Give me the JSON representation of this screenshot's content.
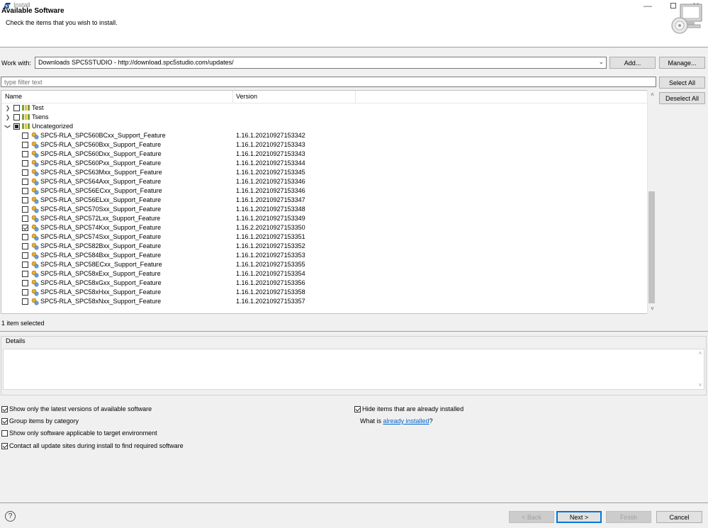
{
  "window": {
    "title": "Install"
  },
  "header": {
    "title": "Available Software",
    "subtitle": "Check the items that you wish to install."
  },
  "work_with": {
    "label": "Work with:",
    "value": "Downloads SPC5STUDIO - http://download.spc5studio.com/updates/",
    "add_label": "Add...",
    "manage_label": "Manage..."
  },
  "filter": {
    "placeholder": "type filter text"
  },
  "selection_buttons": {
    "select_all": "Select All",
    "deselect_all": "Deselect All"
  },
  "tree": {
    "columns": [
      "Name",
      "Version"
    ],
    "categories": [
      {
        "name": "Test",
        "expanded": false,
        "state": "unchecked"
      },
      {
        "name": "Tsens",
        "expanded": false,
        "state": "unchecked"
      },
      {
        "name": "Uncategorized",
        "expanded": true,
        "state": "partial"
      }
    ],
    "features": [
      {
        "name": "SPC5-RLA_SPC560BCxx_Support_Feature",
        "version": "1.16.1.20210927153342",
        "checked": false
      },
      {
        "name": "SPC5-RLA_SPC560Bxx_Support_Feature",
        "version": "1.16.1.20210927153343",
        "checked": false
      },
      {
        "name": "SPC5-RLA_SPC560Dxx_Support_Feature",
        "version": "1.16.1.20210927153343",
        "checked": false
      },
      {
        "name": "SPC5-RLA_SPC560Pxx_Support_Feature",
        "version": "1.16.1.20210927153344",
        "checked": false
      },
      {
        "name": "SPC5-RLA_SPC563Mxx_Support_Feature",
        "version": "1.16.1.20210927153345",
        "checked": false
      },
      {
        "name": "SPC5-RLA_SPC564Axx_Support_Feature",
        "version": "1.16.1.20210927153346",
        "checked": false
      },
      {
        "name": "SPC5-RLA_SPC56ECxx_Support_Feature",
        "version": "1.16.1.20210927153346",
        "checked": false
      },
      {
        "name": "SPC5-RLA_SPC56ELxx_Support_Feature",
        "version": "1.16.1.20210927153347",
        "checked": false
      },
      {
        "name": "SPC5-RLA_SPC570Sxx_Support_Feature",
        "version": "1.16.1.20210927153348",
        "checked": false
      },
      {
        "name": "SPC5-RLA_SPC572Lxx_Support_Feature",
        "version": "1.16.1.20210927153349",
        "checked": false
      },
      {
        "name": "SPC5-RLA_SPC574Kxx_Support_Feature",
        "version": "1.16.2.20210927153350",
        "checked": true
      },
      {
        "name": "SPC5-RLA_SPC574Sxx_Support_Feature",
        "version": "1.16.1.20210927153351",
        "checked": false
      },
      {
        "name": "SPC5-RLA_SPC582Bxx_Support_Feature",
        "version": "1.16.1.20210927153352",
        "checked": false
      },
      {
        "name": "SPC5-RLA_SPC584Bxx_Support_Feature",
        "version": "1.16.1.20210927153353",
        "checked": false
      },
      {
        "name": "SPC5-RLA_SPC58ECxx_Support_Feature",
        "version": "1.16.1.20210927153355",
        "checked": false
      },
      {
        "name": "SPC5-RLA_SPC58xExx_Support_Feature",
        "version": "1.16.1.20210927153354",
        "checked": false
      },
      {
        "name": "SPC5-RLA_SPC58xGxx_Support_Feature",
        "version": "1.16.1.20210927153356",
        "checked": false
      },
      {
        "name": "SPC5-RLA_SPC58xHxx_Support_Feature",
        "version": "1.16.1.20210927153358",
        "checked": false
      },
      {
        "name": "SPC5-RLA_SPC58xNxx_Support_Feature",
        "version": "1.16.1.20210927153357",
        "checked": false
      }
    ]
  },
  "status": "1 item selected",
  "details": {
    "label": "Details"
  },
  "options": {
    "latest_versions": {
      "label": "Show only the latest versions of available software",
      "checked": true
    },
    "group_by_category": {
      "label": "Group items by category",
      "checked": true
    },
    "target_env": {
      "label": "Show only software applicable to target environment",
      "checked": false
    },
    "contact_sites": {
      "label": "Contact all update sites during install to find required software",
      "checked": true
    },
    "hide_installed": {
      "label": "Hide items that are already installed",
      "checked": true
    },
    "what_is_prefix": "What is ",
    "what_is_link": "already installed",
    "what_is_suffix": "?"
  },
  "footer": {
    "back": "< Back",
    "next": "Next >",
    "finish": "Finish",
    "cancel": "Cancel"
  },
  "icons": {
    "app": "st-logo-icon",
    "header": "install-computer-cd-icon",
    "category": "category-folder-icon",
    "feature": "feature-plugin-icon",
    "help": "help-icon"
  },
  "colors": {
    "link": "#0066cc",
    "default_button_border": "#0078d7"
  }
}
